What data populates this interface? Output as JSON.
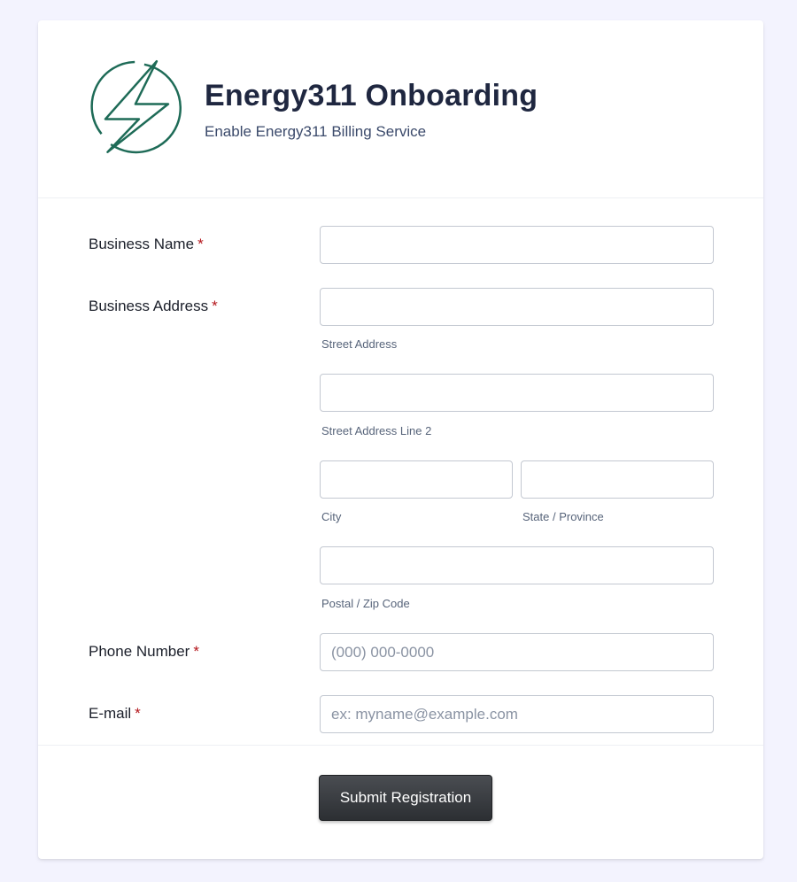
{
  "header": {
    "logo_icon": "lightning-bolt-circle-icon",
    "title": "Energy311 Onboarding",
    "subtitle": "Enable Energy311 Billing Service"
  },
  "form": {
    "required_marker": "*",
    "business_name": {
      "label": "Business Name",
      "value": ""
    },
    "business_address": {
      "label": "Business Address",
      "street": {
        "value": "",
        "sublabel": "Street Address"
      },
      "street2": {
        "value": "",
        "sublabel": "Street Address Line 2"
      },
      "city": {
        "value": "",
        "sublabel": "City"
      },
      "state": {
        "value": "",
        "sublabel": "State / Province"
      },
      "postal": {
        "value": "",
        "sublabel": "Postal / Zip Code"
      }
    },
    "phone": {
      "label": "Phone Number",
      "value": "",
      "placeholder": "(000) 000-0000"
    },
    "email": {
      "label": "E-mail",
      "value": "",
      "placeholder": "ex: myname@example.com"
    },
    "submit_label": "Submit Registration"
  },
  "colors": {
    "background": "#f3f3fe",
    "logo": "#1e6b57",
    "title": "#1f2740",
    "required": "#b3141a",
    "button": "#2c2f33"
  }
}
